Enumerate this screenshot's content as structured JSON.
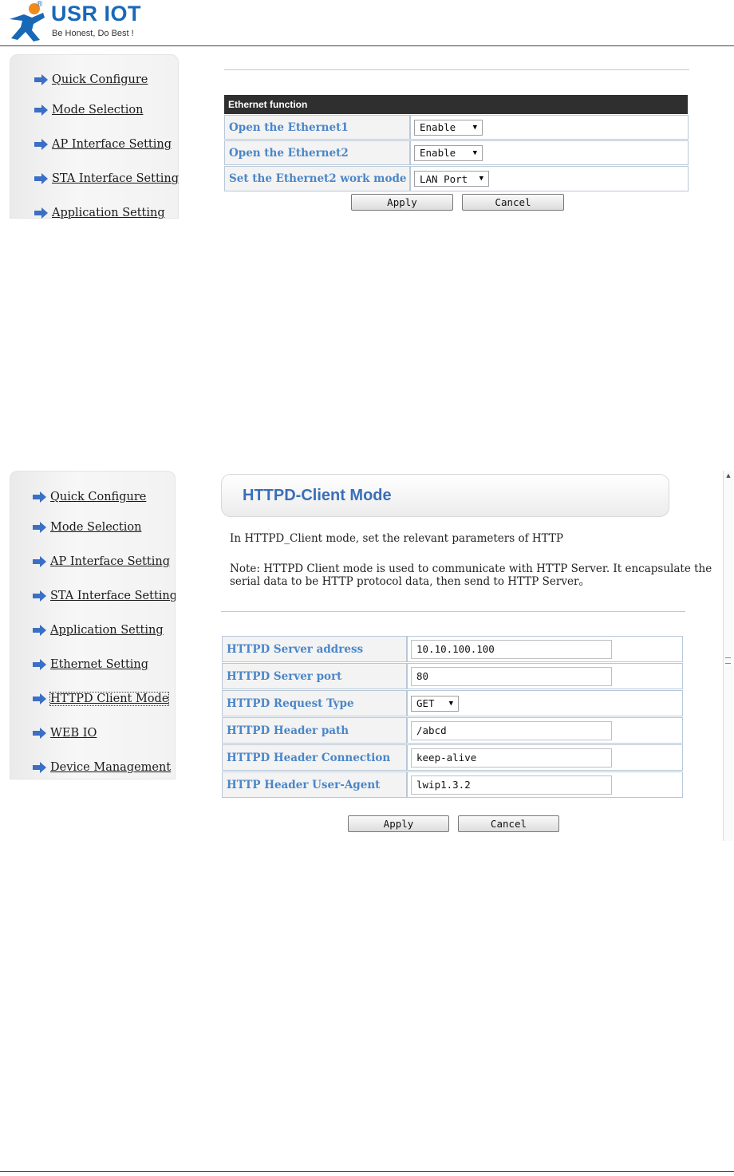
{
  "header": {
    "brand": "USR IOT",
    "registered": "®",
    "tagline": "Be Honest, Do Best !",
    "brand_color": "#1868b8"
  },
  "sidebar1": {
    "items": [
      {
        "label": "Quick Configure",
        "icon": "arrow-right-icon"
      },
      {
        "label": "Mode Selection",
        "icon": "arrow-right-icon"
      },
      {
        "label": "AP Interface Setting",
        "icon": "arrow-right-icon"
      },
      {
        "label": "STA Interface Setting",
        "icon": "arrow-right-icon"
      },
      {
        "label": "Application Setting",
        "icon": "arrow-right-icon"
      }
    ]
  },
  "ethernet": {
    "section_title": "Ethernet function",
    "rows": [
      {
        "label": "Open the Ethernet1",
        "value": "Enable"
      },
      {
        "label": "Open the Ethernet2",
        "value": "Enable"
      },
      {
        "label": "Set the Ethernet2 work mode",
        "value": "LAN Port"
      }
    ],
    "apply_label": "Apply",
    "cancel_label": "Cancel"
  },
  "sidebar2": {
    "items": [
      {
        "label": "Quick Configure"
      },
      {
        "label": "Mode Selection"
      },
      {
        "label": "AP Interface Setting"
      },
      {
        "label": "STA Interface Setting"
      },
      {
        "label": "Application Setting"
      },
      {
        "label": "Ethernet Setting"
      },
      {
        "label": "HTTPD Client Mode",
        "active": true
      },
      {
        "label": "WEB IO"
      },
      {
        "label": "Device Management"
      }
    ]
  },
  "httpd": {
    "title": "HTTPD-Client Mode",
    "description": "In HTTPD_Client mode, set the relevant parameters of HTTP",
    "note_line1": "Note: HTTPD Client mode is used to communicate with HTTP Server. It encapsulate the",
    "note_line2": "serial data to be HTTP protocol data, then send to HTTP Server。",
    "rows": [
      {
        "label": "HTTPD Server address",
        "value": "10.10.100.100",
        "kind": "input"
      },
      {
        "label": "HTTPD Server port",
        "value": "80",
        "kind": "input"
      },
      {
        "label": "HTTPD Request Type",
        "value": "GET",
        "kind": "select"
      },
      {
        "label": "HTTPD Header path",
        "value": "/abcd",
        "kind": "input"
      },
      {
        "label": "HTTPD Header Connection",
        "value": "keep-alive",
        "kind": "input"
      },
      {
        "label": "HTTP Header User-Agent",
        "value": "lwip1.3.2",
        "kind": "input"
      }
    ],
    "apply_label": "Apply",
    "cancel_label": "Cancel",
    "label_color": "#4a86c8"
  }
}
